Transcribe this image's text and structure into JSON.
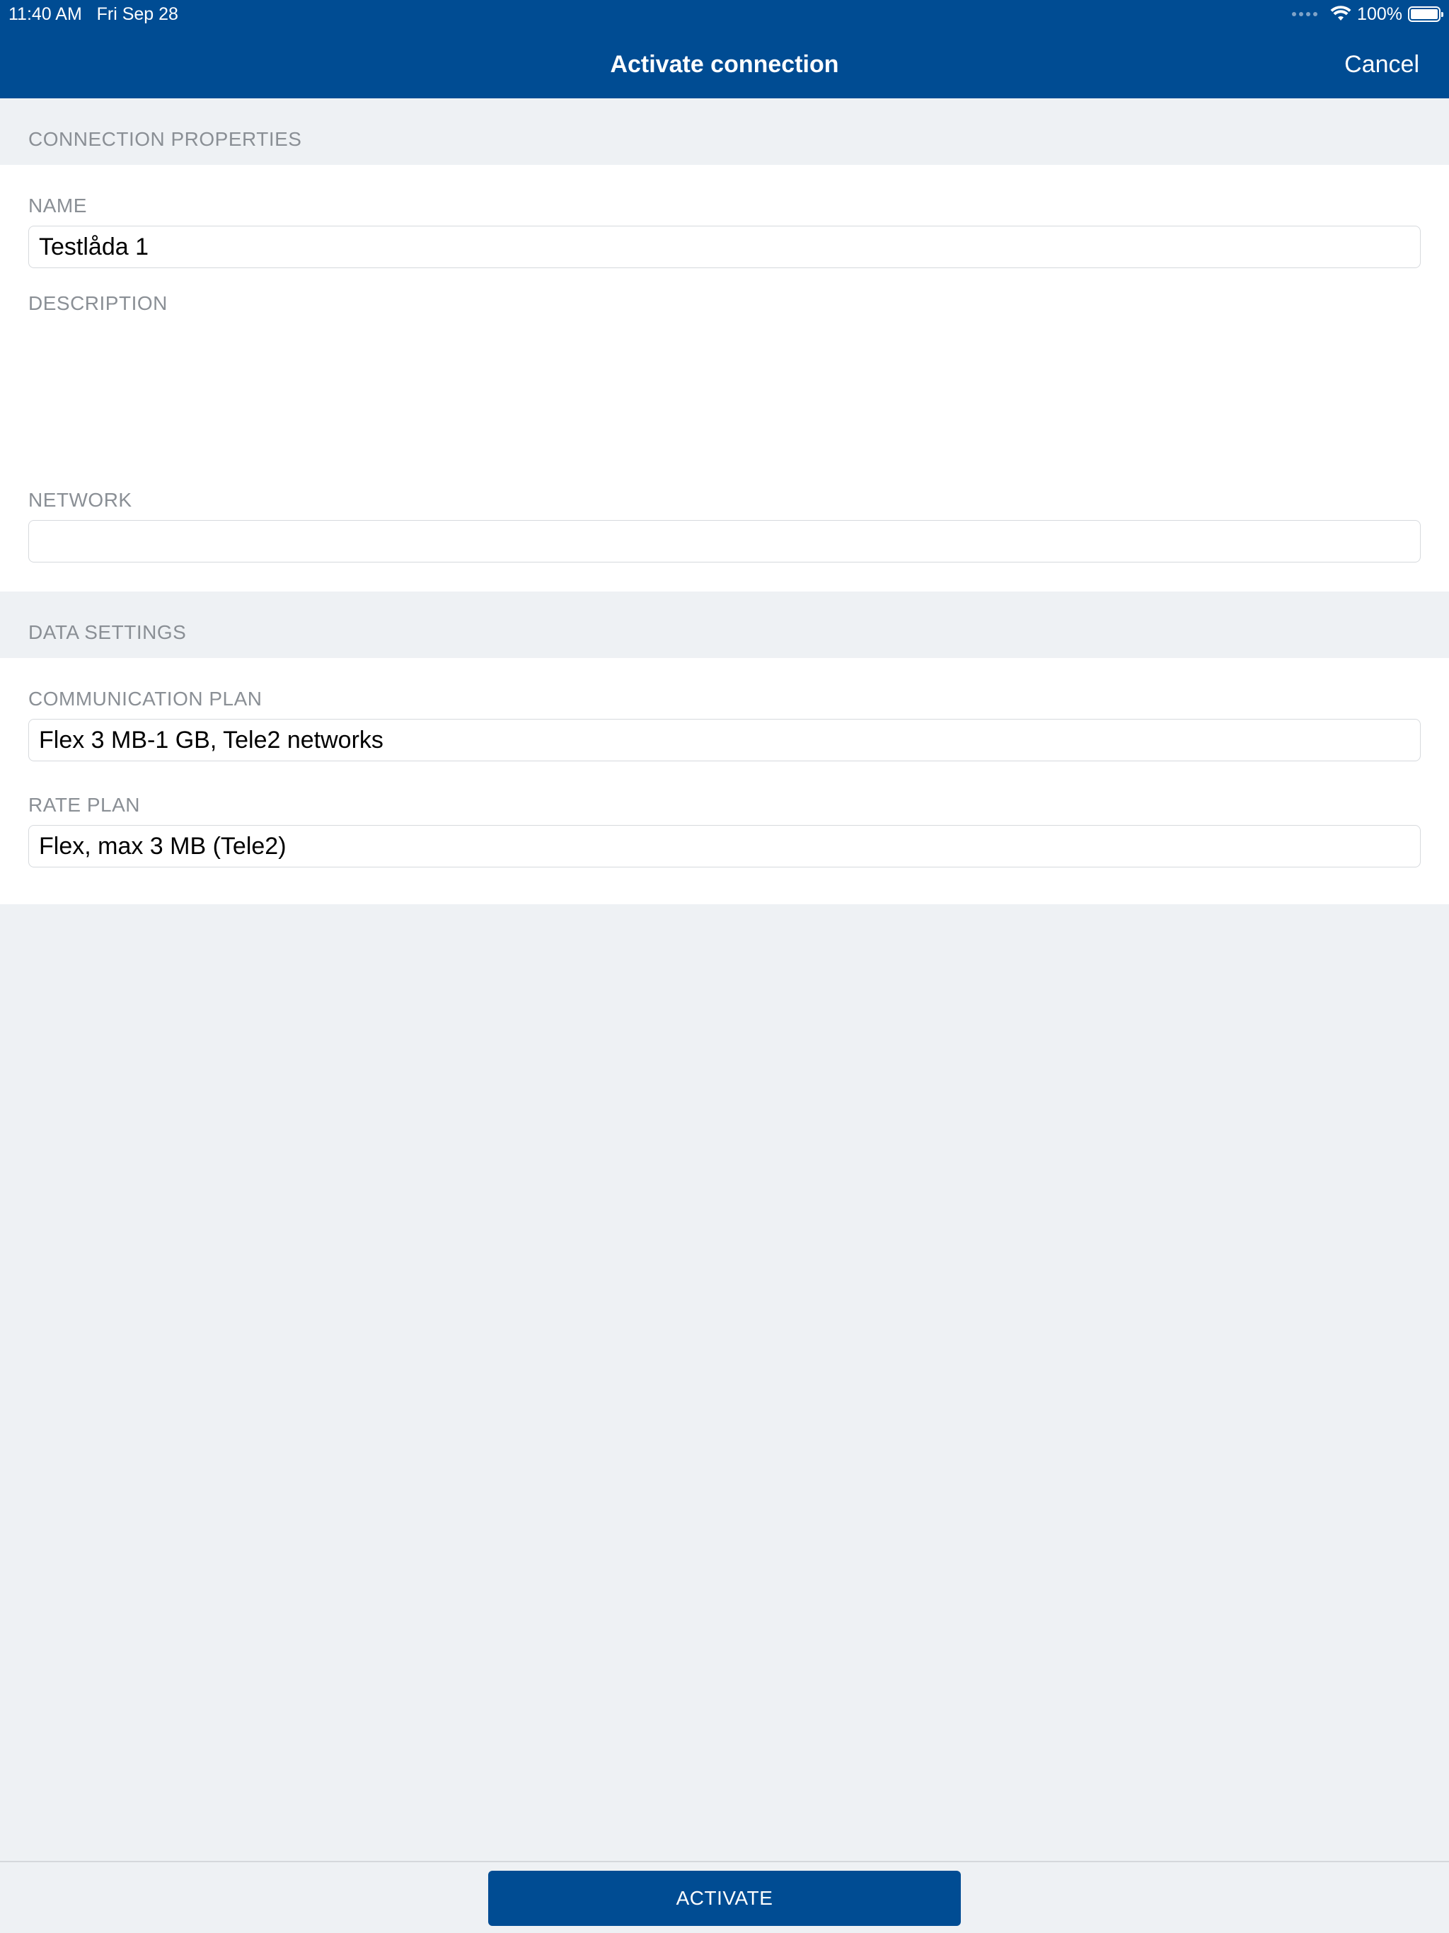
{
  "status_bar": {
    "time": "11:40 AM",
    "date": "Fri Sep 28",
    "battery_percent": "100%",
    "battery_level": 1.0,
    "wifi_icon": "wifi-icon",
    "signal_icon": "signal-dots-icon"
  },
  "nav": {
    "title": "Activate connection",
    "cancel_label": "Cancel"
  },
  "sections": {
    "connection_properties": {
      "header": "CONNECTION PROPERTIES",
      "name_label": "NAME",
      "name_value": "Testlåda 1",
      "description_label": "DESCRIPTION",
      "description_value": "",
      "network_label": "NETWORK",
      "network_value": ""
    },
    "data_settings": {
      "header": "DATA SETTINGS",
      "communication_plan_label": "COMMUNICATION PLAN",
      "communication_plan_value": "Flex 3 MB-1 GB, Tele2 networks",
      "rate_plan_label": "RATE PLAN",
      "rate_plan_value": "Flex, max 3 MB (Tele2)"
    }
  },
  "footer": {
    "activate_label": "ACTIVATE"
  },
  "colors": {
    "brand_blue": "#004c93",
    "background": "#eef1f4",
    "label_gray": "#8a8f95",
    "field_border": "#d6d9dd"
  }
}
